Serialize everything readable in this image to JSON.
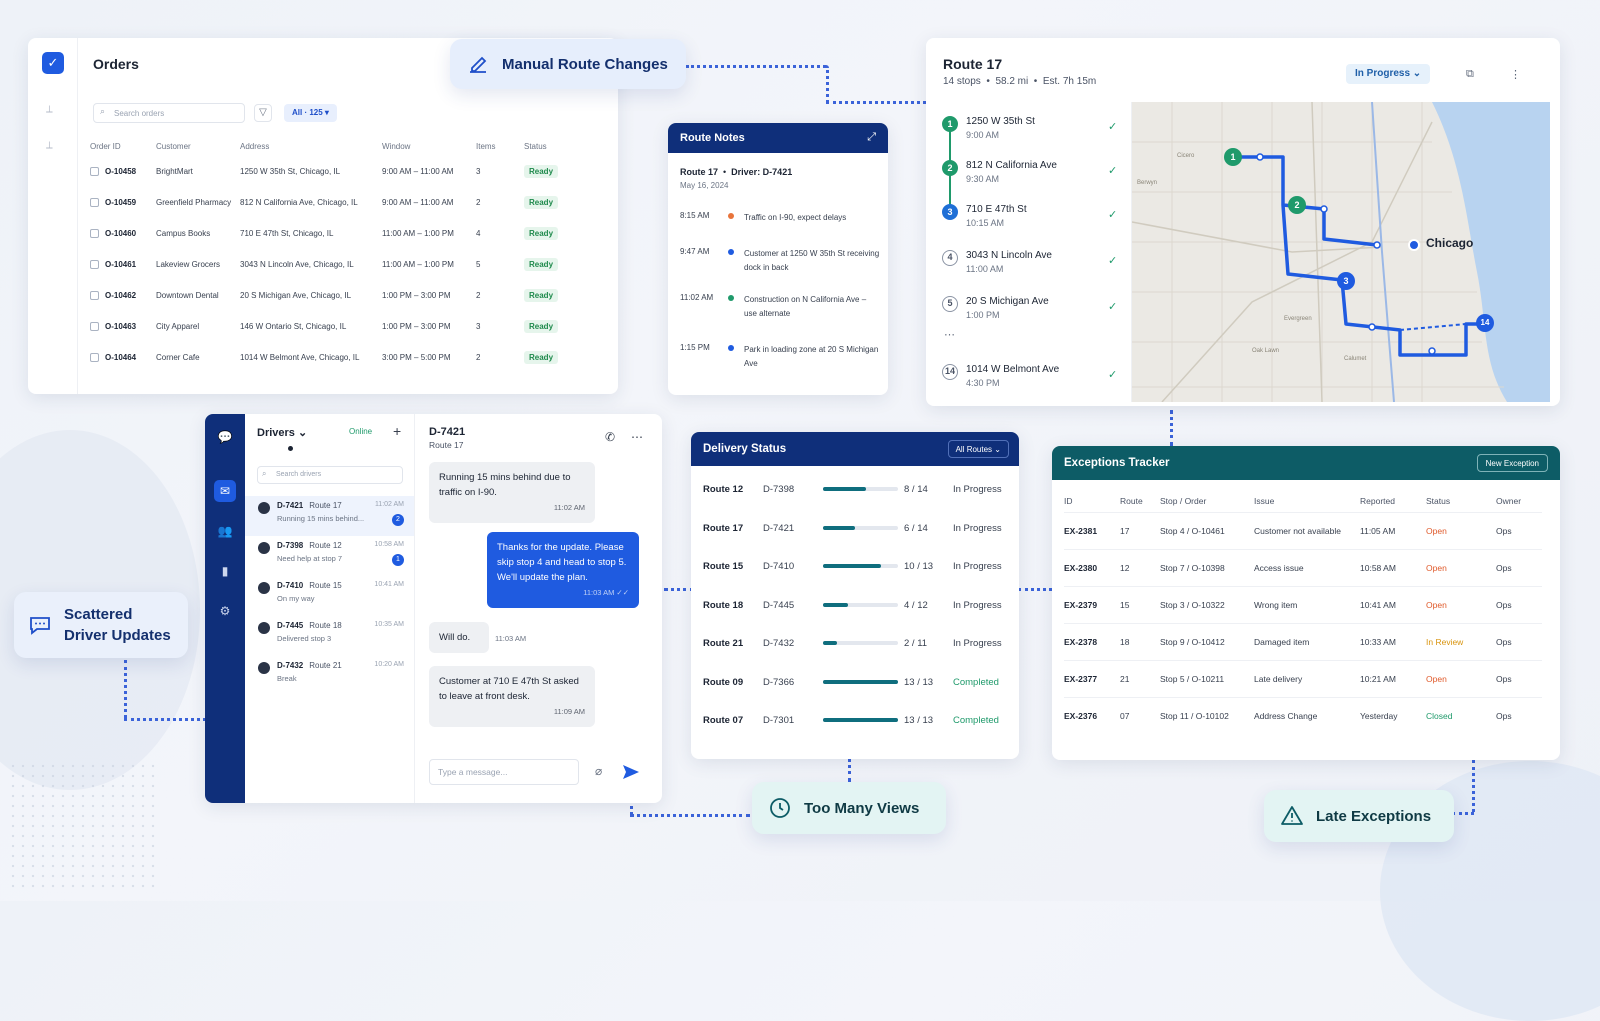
{
  "callouts": {
    "manual": "Manual Route Changes",
    "scattered_line1": "Scattered",
    "scattered_line2": "Driver Updates",
    "views": "Too Many Views",
    "late": "Late Exceptions"
  },
  "orders": {
    "title": "Orders",
    "search_placeholder": "Search orders",
    "filter_chip": "All · 125",
    "columns": [
      "Order ID",
      "Customer",
      "Address",
      "Window",
      "Items",
      "Status"
    ],
    "rows": [
      {
        "id": "O-10458",
        "customer": "BrightMart",
        "address": "1250 W 35th St, Chicago, IL",
        "window": "9:00 AM – 11:00 AM",
        "items": "3",
        "status": "Ready"
      },
      {
        "id": "O-10459",
        "customer": "Greenfield Pharmacy",
        "address": "812 N California Ave, Chicago, IL",
        "window": "9:00 AM – 11:00 AM",
        "items": "2",
        "status": "Ready"
      },
      {
        "id": "O-10460",
        "customer": "Campus Books",
        "address": "710 E 47th St, Chicago, IL",
        "window": "11:00 AM – 1:00 PM",
        "items": "4",
        "status": "Ready"
      },
      {
        "id": "O-10461",
        "customer": "Lakeview Grocers",
        "address": "3043 N Lincoln Ave, Chicago, IL",
        "window": "11:00 AM – 1:00 PM",
        "items": "5",
        "status": "Ready"
      },
      {
        "id": "O-10462",
        "customer": "Downtown Dental",
        "address": "20 S Michigan Ave, Chicago, IL",
        "window": "1:00 PM – 3:00 PM",
        "items": "2",
        "status": "Ready"
      },
      {
        "id": "O-10463",
        "customer": "City Apparel",
        "address": "146 W Ontario St, Chicago, IL",
        "window": "1:00 PM – 3:00 PM",
        "items": "3",
        "status": "Ready"
      },
      {
        "id": "O-10464",
        "customer": "Corner Cafe",
        "address": "1014 W Belmont Ave, Chicago, IL",
        "window": "3:00 PM – 5:00 PM",
        "items": "2",
        "status": "Ready"
      }
    ]
  },
  "route": {
    "title": "Route 17",
    "stops_summary": "14 stops",
    "distance": "58.2 mi",
    "eta": "Est. 7h 15m",
    "status": "In Progress",
    "ellipsis": "⋯",
    "map_label": "Chicago",
    "stops": [
      {
        "num": "1",
        "address": "1250 W 35th St",
        "time": "9:00 AM",
        "style": "green"
      },
      {
        "num": "2",
        "address": "812 N California Ave",
        "time": "9:30 AM",
        "style": "green"
      },
      {
        "num": "3",
        "address": "710 E 47th St",
        "time": "10:15 AM",
        "style": "blue"
      },
      {
        "num": "4",
        "address": "3043 N Lincoln Ave",
        "time": "11:00 AM",
        "style": "outline"
      },
      {
        "num": "5",
        "address": "20 S Michigan Ave",
        "time": "1:00 PM",
        "style": "outline"
      },
      {
        "num": "14",
        "address": "1014 W Belmont Ave",
        "time": "4:30 PM",
        "style": "outline"
      }
    ],
    "map_markers": [
      "1",
      "2",
      "3",
      "14"
    ]
  },
  "notes": {
    "title": "Route Notes",
    "route": "Route 17",
    "driver": "Driver: D-7421",
    "date": "May 16, 2024",
    "items": [
      {
        "time": "8:15 AM",
        "text": "Traffic on I-90, expect delays",
        "dot": "#e8743b"
      },
      {
        "time": "9:47 AM",
        "text": "Customer at 1250 W 35th St receiving dock in back",
        "dot": "#1f5be0"
      },
      {
        "time": "11:02 AM",
        "text": "Construction on N California Ave – use alternate",
        "dot": "#1f9a6b"
      },
      {
        "time": "1:15 PM",
        "text": "Park in loading zone at 20 S Michigan Ave",
        "dot": "#1f5be0"
      }
    ]
  },
  "chat": {
    "drivers_label": "Drivers",
    "online_label": "Online",
    "search_placeholder": "Search drivers",
    "drivers": [
      {
        "id": "D-7421",
        "route": "Route 17",
        "msg": "Running 15 mins behind...",
        "time": "11:02 AM",
        "badge": "2"
      },
      {
        "id": "D-7398",
        "route": "Route 12",
        "msg": "Need help at stop 7",
        "time": "10:58 AM",
        "badge": "1"
      },
      {
        "id": "D-7410",
        "route": "Route 15",
        "msg": "On my way",
        "time": "10:41 AM",
        "badge": ""
      },
      {
        "id": "D-7445",
        "route": "Route 18",
        "msg": "Delivered stop 3",
        "time": "10:35 AM",
        "badge": ""
      },
      {
        "id": "D-7432",
        "route": "Route 21",
        "msg": "Break",
        "time": "10:20 AM",
        "badge": ""
      }
    ],
    "conversation": {
      "driver": "D-7421",
      "route": "Route 17",
      "messages": [
        {
          "text": "Running 15 mins behind due to traffic on I-90.",
          "time": "11:02 AM"
        },
        {
          "text": "Thanks for the update. Please skip stop 4 and head to stop 5. We'll update the plan.",
          "time": "11:03 AM ✓✓"
        },
        {
          "text": "Will do.",
          "time": "11:03 AM"
        },
        {
          "text": "Customer at 710 E 47th St asked to leave at front desk.",
          "time": "11:09 AM"
        }
      ],
      "input_placeholder": "Type a message..."
    }
  },
  "delivery": {
    "title": "Delivery Status",
    "filter": "All Routes",
    "rows": [
      {
        "route": "Route 12",
        "driver": "D-7398",
        "done": 8,
        "total": 14,
        "count": "8 / 14",
        "status": "In Progress"
      },
      {
        "route": "Route 17",
        "driver": "D-7421",
        "done": 6,
        "total": 14,
        "count": "6 / 14",
        "status": "In Progress"
      },
      {
        "route": "Route 15",
        "driver": "D-7410",
        "done": 10,
        "total": 13,
        "count": "10 / 13",
        "status": "In Progress"
      },
      {
        "route": "Route 18",
        "driver": "D-7445",
        "done": 4,
        "total": 12,
        "count": "4 / 12",
        "status": "In Progress"
      },
      {
        "route": "Route 21",
        "driver": "D-7432",
        "done": 2,
        "total": 11,
        "count": "2 / 11",
        "status": "In Progress"
      },
      {
        "route": "Route 09",
        "driver": "D-7366",
        "done": 13,
        "total": 13,
        "count": "13 / 13",
        "status": "Completed"
      },
      {
        "route": "Route 07",
        "driver": "D-7301",
        "done": 13,
        "total": 13,
        "count": "13 / 13",
        "status": "Completed"
      }
    ]
  },
  "exceptions": {
    "title": "Exceptions Tracker",
    "new_button": "New Exception",
    "columns": [
      "ID",
      "Route",
      "Stop / Order",
      "Issue",
      "Reported",
      "Status",
      "Owner"
    ],
    "rows": [
      {
        "id": "EX-2381",
        "route": "17",
        "stop": "Stop 4 / O-10461",
        "issue": "Customer not available",
        "reported": "11:05 AM",
        "status": "Open",
        "owner": "Ops"
      },
      {
        "id": "EX-2380",
        "route": "12",
        "stop": "Stop 7 / O-10398",
        "issue": "Access issue",
        "reported": "10:58 AM",
        "status": "Open",
        "owner": "Ops"
      },
      {
        "id": "EX-2379",
        "route": "15",
        "stop": "Stop 3 / O-10322",
        "issue": "Wrong item",
        "reported": "10:41 AM",
        "status": "Open",
        "owner": "Ops"
      },
      {
        "id": "EX-2378",
        "route": "18",
        "stop": "Stop 9 / O-10412",
        "issue": "Damaged item",
        "reported": "10:33 AM",
        "status": "In Review",
        "owner": "Ops"
      },
      {
        "id": "EX-2377",
        "route": "21",
        "stop": "Stop 5 / O-10211",
        "issue": "Late delivery",
        "reported": "10:21 AM",
        "status": "Open",
        "owner": "Ops"
      },
      {
        "id": "EX-2376",
        "route": "07",
        "stop": "Stop 11 / O-10102",
        "issue": "Address Change",
        "reported": "Yesterday",
        "status": "Closed",
        "owner": "Ops"
      }
    ]
  },
  "colors": {
    "navy": "#0f2f7a",
    "accent": "#1f5be0",
    "teal": "#0d5c66",
    "green": "#1f9a6b",
    "open": "#e05a2b",
    "review": "#d99510"
  }
}
